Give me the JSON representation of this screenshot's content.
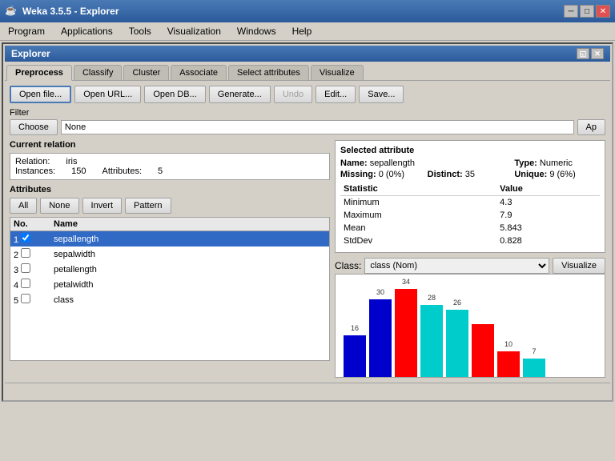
{
  "title_bar": {
    "icon": "☕",
    "title": "Weka 3.5.5 - Explorer",
    "minimize": "─",
    "maximize": "□",
    "close": "✕"
  },
  "menu": {
    "items": [
      "Program",
      "Applications",
      "Tools",
      "Visualization",
      "Windows",
      "Help"
    ]
  },
  "explorer": {
    "title": "Explorer",
    "tabs": [
      "Preprocess",
      "Classify",
      "Cluster",
      "Associate",
      "Select attributes",
      "Visualize"
    ],
    "active_tab": 0
  },
  "toolbar": {
    "open_file": "Open file...",
    "open_url": "Open URL...",
    "open_db": "Open DB...",
    "generate": "Generate...",
    "undo": "Undo",
    "edit": "Edit...",
    "save": "Save..."
  },
  "filter": {
    "label": "Filter",
    "choose": "Choose",
    "value": "None",
    "apply": "Ap"
  },
  "current_relation": {
    "title": "Current relation",
    "relation_label": "Relation:",
    "relation_value": "iris",
    "instances_label": "Instances:",
    "instances_value": "150",
    "attributes_label": "Attributes:",
    "attributes_value": "5"
  },
  "attributes": {
    "title": "Attributes",
    "all": "All",
    "none": "None",
    "invert": "Invert",
    "pattern": "Pattern",
    "columns": [
      "No.",
      "Name"
    ],
    "rows": [
      {
        "no": 1,
        "name": "sepallength",
        "checked": true,
        "selected": true
      },
      {
        "no": 2,
        "name": "sepalwidth",
        "checked": false,
        "selected": false
      },
      {
        "no": 3,
        "name": "petallength",
        "checked": false,
        "selected": false
      },
      {
        "no": 4,
        "name": "petalwidth",
        "checked": false,
        "selected": false
      },
      {
        "no": 5,
        "name": "class",
        "checked": false,
        "selected": false
      }
    ]
  },
  "selected_attribute": {
    "title": "Selected attribute",
    "name_label": "Name:",
    "name_value": "sepallength",
    "type_label": "Type:",
    "type_value": "Numeric",
    "missing_label": "Missing:",
    "missing_value": "0 (0%)",
    "distinct_label": "Distinct:",
    "distinct_value": "35",
    "unique_label": "Unique:",
    "unique_value": "9 (6%)",
    "stats": {
      "headers": [
        "Statistic",
        "Value"
      ],
      "rows": [
        {
          "stat": "Minimum",
          "value": "4.3"
        },
        {
          "stat": "Maximum",
          "value": "7.9"
        },
        {
          "stat": "Mean",
          "value": "5.843"
        },
        {
          "stat": "StdDev",
          "value": "0.828"
        }
      ]
    }
  },
  "class_selector": {
    "label": "Class:",
    "value": "class (Nom)",
    "visualize": "Visualize"
  },
  "chart": {
    "bars": [
      {
        "label": "16",
        "height_pct": 47,
        "color": "#0000cc",
        "x_label": ""
      },
      {
        "label": "30",
        "height_pct": 88,
        "color": "#0000cc",
        "x_label": ""
      },
      {
        "label": "34",
        "height_pct": 100,
        "color": "#ff0000",
        "x_label": ""
      },
      {
        "label": "28",
        "height_pct": 82,
        "color": "#00cccc",
        "x_label": ""
      },
      {
        "label": "26",
        "height_pct": 76,
        "color": "#00cccc",
        "x_label": ""
      },
      {
        "label": "",
        "height_pct": 60,
        "color": "#ff0000",
        "x_label": ""
      },
      {
        "label": "10",
        "height_pct": 29,
        "color": "#ff0000",
        "x_label": ""
      },
      {
        "label": "7",
        "height_pct": 21,
        "color": "#00cccc",
        "x_label": ""
      }
    ]
  },
  "status": ""
}
